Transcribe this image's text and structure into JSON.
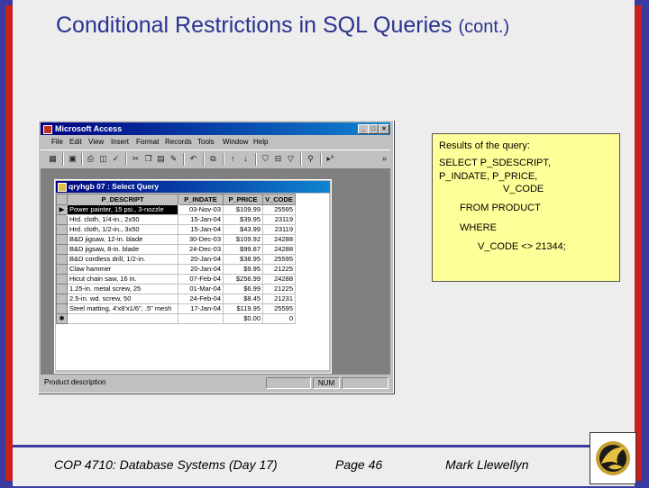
{
  "slide": {
    "title": "Conditional Restrictions in SQL Queries",
    "title_suffix": "(cont.)"
  },
  "access": {
    "window_title": "Microsoft Access",
    "menu": [
      "File",
      "Edit",
      "View",
      "Insert",
      "Format",
      "Records",
      "Tools",
      "Window",
      "Help"
    ],
    "query_title": "qryhgb 07 : Select Query",
    "columns": [
      "P_DESCRIPT",
      "P_INDATE",
      "P_PRICE",
      "V_CODE"
    ],
    "rows": [
      [
        "Power painter, 15 psi., 3-nozzle",
        "03-Nov-03",
        "$109.99",
        "25595"
      ],
      [
        "Hrd. cloth, 1/4-in., 2x50",
        "15-Jan-04",
        "$39.95",
        "23119"
      ],
      [
        "Hrd. cloth, 1/2-in., 3x50",
        "15-Jan-04",
        "$43.99",
        "23119"
      ],
      [
        "B&D jigsaw, 12-in. blade",
        "30-Dec-03",
        "$109.92",
        "24288"
      ],
      [
        "B&D jigsaw, 8-in. blade",
        "24-Dec-03",
        "$99.87",
        "24288"
      ],
      [
        "B&D cordless drill, 1/2-in.",
        "20-Jan-04",
        "$38.95",
        "25595"
      ],
      [
        "Claw hammer",
        "20-Jan-04",
        "$9.95",
        "21225"
      ],
      [
        "Hicut chain saw, 16 in.",
        "07-Feb-04",
        "$256.99",
        "24288"
      ],
      [
        "1.25-in. metal screw, 25",
        "01-Mar-04",
        "$6.99",
        "21225"
      ],
      [
        "2.5-in. wd. screw, 50",
        "24-Feb-04",
        "$8.45",
        "21231"
      ],
      [
        "Steel matting, 4'x8'x1/6\", .5\" mesh",
        "17-Jan-04",
        "$119.95",
        "25595"
      ]
    ],
    "new_row": {
      "price": "$0.00",
      "vcode": "0"
    },
    "status_text": "Product description",
    "status_num": "NUM"
  },
  "note": {
    "heading": "Results of the query:",
    "line1": "SELECT P_SDESCRIPT,",
    "line2": "P_INDATE,  P_PRICE,",
    "line3": "V_CODE",
    "line4": "FROM PRODUCT",
    "line5": "WHERE",
    "line6": "V_CODE <> 21344;"
  },
  "footer": {
    "course": "COP 4710: Database Systems  (Day 17)",
    "page": "Page 46",
    "author": "Mark Llewellyn"
  },
  "colors": {
    "frame_blue": "#3a3aa0",
    "frame_red": "#c8201a",
    "title_text": "#2a3290",
    "note_bg": "#ffff99",
    "titlebar": "#000080"
  }
}
